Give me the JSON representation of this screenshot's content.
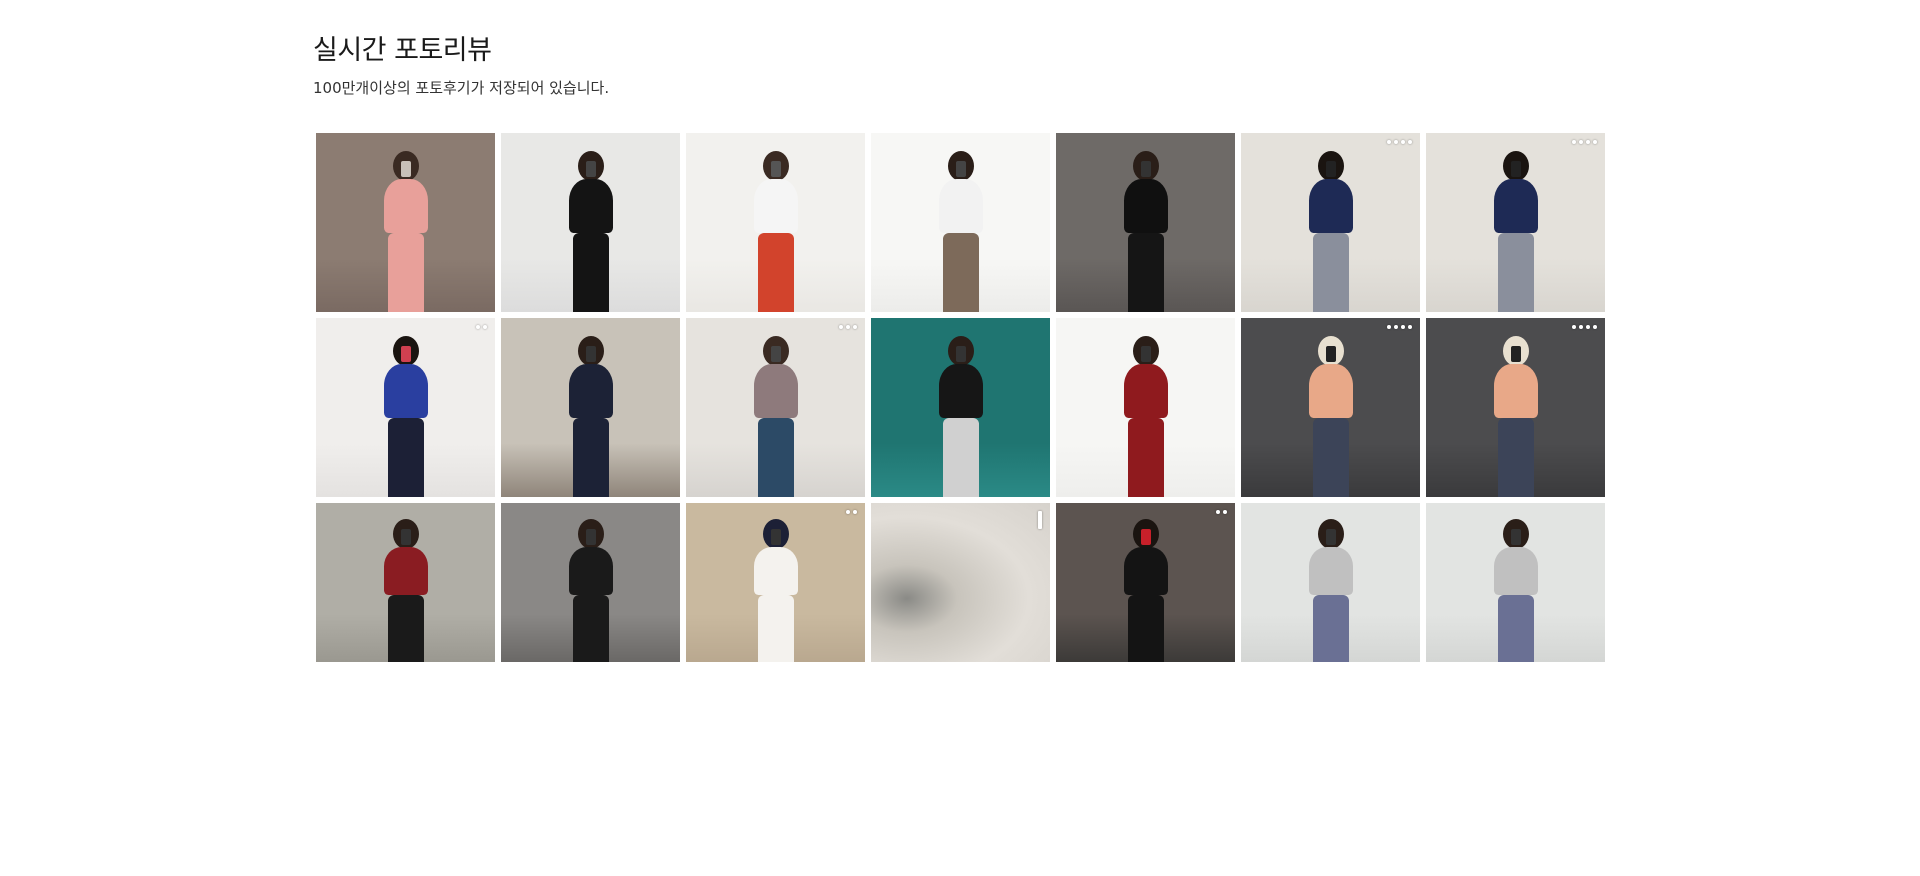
{
  "header": {
    "title": "실시간 포토리뷰",
    "subtitle": "100만개이상의 포토후기가 저장되어 있습니다."
  },
  "photos": [
    {
      "id": 1,
      "bg": "#7a6a62",
      "wall": "#8c7c72",
      "top": "#e8a09a",
      "bottom": "#e8a09a",
      "hair": "#3a2a22",
      "phone": "#c8c0b8",
      "indicator": "none"
    },
    {
      "id": 2,
      "bg": "#dcdcdc",
      "wall": "#e8e8e6",
      "top": "#141414",
      "bottom": "#141414",
      "hair": "#2a1e18",
      "phone": "#444444",
      "indicator": "none"
    },
    {
      "id": 3,
      "bg": "#e9e7e3",
      "wall": "#f2f1ee",
      "top": "#f5f5f5",
      "bottom": "#d2432c",
      "hair": "#3a2a22",
      "phone": "#555555",
      "indicator": "none"
    },
    {
      "id": 4,
      "bg": "#ececea",
      "wall": "#f7f7f5",
      "top": "#f2f2f2",
      "bottom": "#7d6a5a",
      "hair": "#2a1e18",
      "phone": "#444444",
      "indicator": "none"
    },
    {
      "id": 5,
      "bg": "#5a5654",
      "wall": "#6e6a67",
      "top": "#101010",
      "bottom": "#151515",
      "hair": "#2a1e18",
      "phone": "#333333",
      "indicator": "none"
    },
    {
      "id": 6,
      "bg": "#d8d5cf",
      "wall": "#e4e1db",
      "top": "#1e2a55",
      "bottom": "#8a8f9c",
      "hair": "#1a1410",
      "phone": "#222222",
      "indicator": "four-dots"
    },
    {
      "id": 7,
      "bg": "#d8d5cf",
      "wall": "#e4e1db",
      "top": "#1e2a55",
      "bottom": "#8a8f9c",
      "hair": "#1a1410",
      "phone": "#222222",
      "indicator": "four-dots"
    },
    {
      "id": 8,
      "bg": "#e4e2e0",
      "wall": "#f0eeec",
      "top": "#2a3fa0",
      "bottom": "#1c2036",
      "hair": "#1a1410",
      "phone": "#d04050",
      "indicator": "two-dots"
    },
    {
      "id": 9,
      "bg": "#8f857a",
      "wall": "#c8c2b8",
      "top": "#1c2236",
      "bottom": "#1c2236",
      "hair": "#2a1e18",
      "phone": "#333333",
      "indicator": "none"
    },
    {
      "id": 10,
      "bg": "#d6d3cf",
      "wall": "#e6e3de",
      "top": "#8e7a7c",
      "bottom": "#2c4a66",
      "hair": "#3a2a22",
      "phone": "#444444",
      "indicator": "three-dots"
    },
    {
      "id": 11,
      "bg": "#2b8a86",
      "wall": "#1f7571",
      "top": "#161616",
      "bottom": "#d0d0d0",
      "hair": "#2a1e18",
      "phone": "#333333",
      "indicator": "none"
    },
    {
      "id": 12,
      "bg": "#eeeeec",
      "wall": "#f6f6f4",
      "top": "#8f1a1e",
      "bottom": "#8f1a1e",
      "hair": "#2a1e18",
      "phone": "#333333",
      "indicator": "none"
    },
    {
      "id": 13,
      "bg": "#3a3a3c",
      "wall": "#4c4c4e",
      "top": "#e8a888",
      "bottom": "#3c4458",
      "hair": "#e8e0d0",
      "phone": "#222222",
      "indicator": "four-dots"
    },
    {
      "id": 14,
      "bg": "#3a3a3c",
      "wall": "#4c4c4e",
      "top": "#e8a888",
      "bottom": "#3c4458",
      "hair": "#e8e0d0",
      "phone": "#222222",
      "indicator": "four-dots"
    },
    {
      "id": 15,
      "bg": "#9a9890",
      "wall": "#b0aea6",
      "top": "#8a1c22",
      "bottom": "#1a1a1a",
      "hair": "#2a1e18",
      "phone": "#333333",
      "indicator": "none"
    },
    {
      "id": 16,
      "bg": "#6a6866",
      "wall": "#8a8886",
      "top": "#1a1a1a",
      "bottom": "#1a1a1a",
      "hair": "#2a1e18",
      "phone": "#333333",
      "indicator": "none"
    },
    {
      "id": 17,
      "bg": "#b9a88f",
      "wall": "#c9b99f",
      "top": "#f4f2ee",
      "bottom": "#f4f2ee",
      "hair": "#1c2036",
      "phone": "#333333",
      "indicator": "two-dots"
    },
    {
      "id": 18,
      "bg": "#dcd8d2",
      "wall": "#e6e2dc",
      "top": "#e6e2dc",
      "bottom": "#e6e2dc",
      "hair": "#e6e2dc",
      "phone": "#e6e2dc",
      "indicator": "bar"
    },
    {
      "id": 19,
      "bg": "#3c3a38",
      "wall": "#5c5450",
      "top": "#141414",
      "bottom": "#141414",
      "hair": "#1a1410",
      "phone": "#c8202a",
      "indicator": "two-dots"
    },
    {
      "id": 20,
      "bg": "#d4d6d4",
      "wall": "#e2e4e2",
      "top": "#c0c0c0",
      "bottom": "#6a7094",
      "hair": "#2a1e18",
      "phone": "#333333",
      "indicator": "none"
    },
    {
      "id": 21,
      "bg": "#d4d6d4",
      "wall": "#e2e4e2",
      "top": "#c0c0c0",
      "bottom": "#6a7094",
      "hair": "#2a1e18",
      "phone": "#333333",
      "indicator": "none"
    }
  ]
}
